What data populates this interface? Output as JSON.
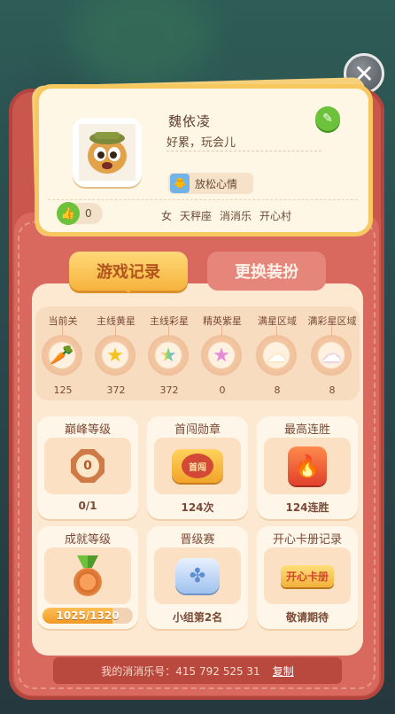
{
  "close_label": "✕",
  "profile": {
    "name": "魏依凌",
    "signature": "好累，玩会儿",
    "mood": "放松心情",
    "likes": "0",
    "tags": [
      "女",
      "天秤座",
      "消消乐",
      "开心村"
    ]
  },
  "tabs": [
    {
      "label": "游戏记录",
      "active": true
    },
    {
      "label": "更换装扮",
      "active": false
    }
  ],
  "stars": [
    {
      "label": "当前关",
      "value": "125",
      "icon": "carrot-icon",
      "glyph": "🥕"
    },
    {
      "label": "主线黄星",
      "value": "372",
      "icon": "yellow-star-icon",
      "glyph": "⭐"
    },
    {
      "label": "主线彩星",
      "value": "372",
      "icon": "rainbow-star-icon",
      "glyph": "🌟"
    },
    {
      "label": "精英紫星",
      "value": "0",
      "icon": "purple-star-icon",
      "glyph": "★"
    },
    {
      "label": "满星区域",
      "value": "8",
      "icon": "cloud-star-icon",
      "glyph": "☁"
    },
    {
      "label": "满彩星区域",
      "value": "8",
      "icon": "rainbow-cloud-icon",
      "glyph": "🌈"
    }
  ],
  "tiles": [
    {
      "title": "巅峰等级",
      "value": "0/1",
      "icon": "peak-badge-icon",
      "badge_text": "0"
    },
    {
      "title": "首闯勋章",
      "value": "124次",
      "icon": "medal-icon",
      "badge_text": "首闯"
    },
    {
      "title": "最高连胜",
      "value": "124连胜",
      "icon": "flame-icon",
      "badge_text": ""
    },
    {
      "title": "成就等级",
      "value": "1025/1320",
      "icon": "achievement-medal-icon",
      "progress": 0.776
    },
    {
      "title": "晋级赛",
      "value": "小组第2名",
      "icon": "clover-badge-icon"
    },
    {
      "title": "开心卡册记录",
      "value": "敬请期待",
      "icon": "card-album-icon",
      "badge_text": "开心卡册"
    }
  ],
  "footer": {
    "id_text": "我的消消乐号：415 792 525 31",
    "copy_label": "复制"
  },
  "colors": {
    "accent": "#f6b33d",
    "wallet": "#c9574e",
    "panel": "#fde9d1",
    "green": "#6cc23b"
  }
}
